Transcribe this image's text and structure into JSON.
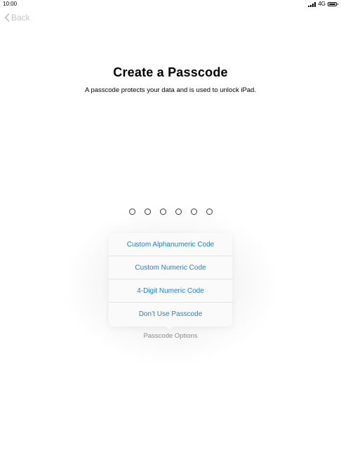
{
  "status_bar": {
    "time": "10:00",
    "network": "4G"
  },
  "nav": {
    "back_label": "Back"
  },
  "header": {
    "title": "Create a Passcode",
    "subtitle": "A passcode protects your data and is used to unlock iPad."
  },
  "passcode": {
    "digits_entered": 0,
    "total_digits": 6
  },
  "options_menu": {
    "items": [
      {
        "label": "Custom Alphanumeric Code"
      },
      {
        "label": "Custom Numeric Code"
      },
      {
        "label": "4-Digit Numeric Code"
      },
      {
        "label": "Don’t Use Passcode"
      }
    ],
    "toggle_label": "Passcode Options"
  },
  "colors": {
    "accent": "#1a82d6",
    "back_disabled": "#c4c4c8",
    "secondary_text": "#8a8a8e"
  }
}
